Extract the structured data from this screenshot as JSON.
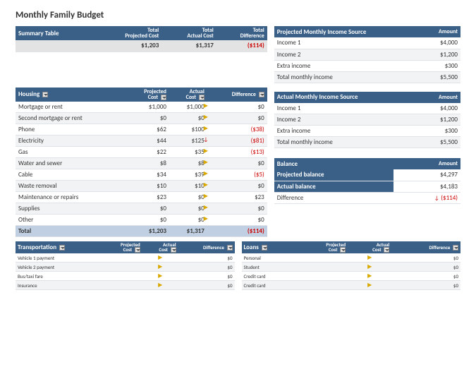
{
  "title": "Monthly Family Budget",
  "summary": {
    "label": "Summary Table",
    "cols": [
      "Total\nProjected Cost",
      "Total\nActual Cost",
      "Total\nDifference"
    ],
    "row": {
      "proj": "$1,203",
      "act": "$1,317",
      "diff": "($114)"
    }
  },
  "housing": {
    "label": "Housing",
    "cols": [
      "Projected\nCost",
      "Actual\nCost",
      "Difference"
    ],
    "rows": [
      {
        "name": "Mortgage or rent",
        "proj": "$1,000",
        "act": "$1,000",
        "icon": "right",
        "diff": "$0"
      },
      {
        "name": "Second mortgage or rent",
        "proj": "$0",
        "act": "$0",
        "icon": "right",
        "diff": "$0"
      },
      {
        "name": "Phone",
        "proj": "$62",
        "act": "$100",
        "icon": "right",
        "diff": "($38)",
        "neg": true
      },
      {
        "name": "Electricity",
        "proj": "$44",
        "act": "$125",
        "icon": "down",
        "diff": "($81)",
        "neg": true
      },
      {
        "name": "Gas",
        "proj": "$22",
        "act": "$35",
        "icon": "right",
        "diff": "($13)",
        "neg": true
      },
      {
        "name": "Water and sewer",
        "proj": "$8",
        "act": "$8",
        "icon": "right",
        "diff": "$0"
      },
      {
        "name": "Cable",
        "proj": "$34",
        "act": "$39",
        "icon": "right",
        "diff": "($5)",
        "neg": true
      },
      {
        "name": "Waste removal",
        "proj": "$10",
        "act": "$10",
        "icon": "right",
        "diff": "$0"
      },
      {
        "name": "Maintenance or repairs",
        "proj": "$23",
        "act": "$0",
        "icon": "right",
        "diff": "$23"
      },
      {
        "name": "Supplies",
        "proj": "$0",
        "act": "$0",
        "icon": "right",
        "diff": "$0"
      },
      {
        "name": "Other",
        "proj": "$0",
        "act": "$0",
        "icon": "right",
        "diff": "$0"
      }
    ],
    "total": {
      "name": "Total",
      "proj": "$1,203",
      "act": "$1,317",
      "diff": "($114)",
      "neg": true
    }
  },
  "projIncome": {
    "label": "Projected Monthly Income Source",
    "amtLabel": "Amount",
    "rows": [
      {
        "name": "Income 1",
        "val": "$4,000"
      },
      {
        "name": "Income 2",
        "val": "$1,200"
      },
      {
        "name": "Extra income",
        "val": "$300"
      },
      {
        "name": "Total monthly income",
        "val": "$5,500"
      }
    ]
  },
  "actIncome": {
    "label": "Actual Monthly Income Source",
    "amtLabel": "Amount",
    "rows": [
      {
        "name": "Income 1",
        "val": "$4,000"
      },
      {
        "name": "Income 2",
        "val": "$1,200"
      },
      {
        "name": "Extra income",
        "val": "$300"
      },
      {
        "name": "Total monthly income",
        "val": "$5,500"
      }
    ]
  },
  "balance": {
    "label": "Balance",
    "amtLabel": "Amount",
    "rows": [
      {
        "name": "Projected balance",
        "val": "$4,297"
      },
      {
        "name": "Actual balance",
        "val": "$4,183"
      },
      {
        "name": "Difference",
        "val": "($114)",
        "neg": true,
        "icon": "down"
      }
    ]
  },
  "transport": {
    "label": "Transportation",
    "cols": [
      "Projected\nCost",
      "Actual\nCost",
      "Difference"
    ],
    "rows": [
      {
        "name": "Vehicle 1 payment",
        "diff": "$0"
      },
      {
        "name": "Vehicle 2 payment",
        "diff": "$0"
      },
      {
        "name": "Bus/taxi fare",
        "diff": "$0"
      },
      {
        "name": "Insurance",
        "diff": "$0"
      }
    ]
  },
  "loans": {
    "label": "Loans",
    "cols": [
      "Projected\nCost",
      "Actual\nCost",
      "Difference"
    ],
    "rows": [
      {
        "name": "Personal",
        "diff": "$0"
      },
      {
        "name": "Student",
        "diff": "$0"
      },
      {
        "name": "Credit card",
        "diff": "$0"
      },
      {
        "name": "Credit card",
        "diff": "$0"
      }
    ]
  }
}
